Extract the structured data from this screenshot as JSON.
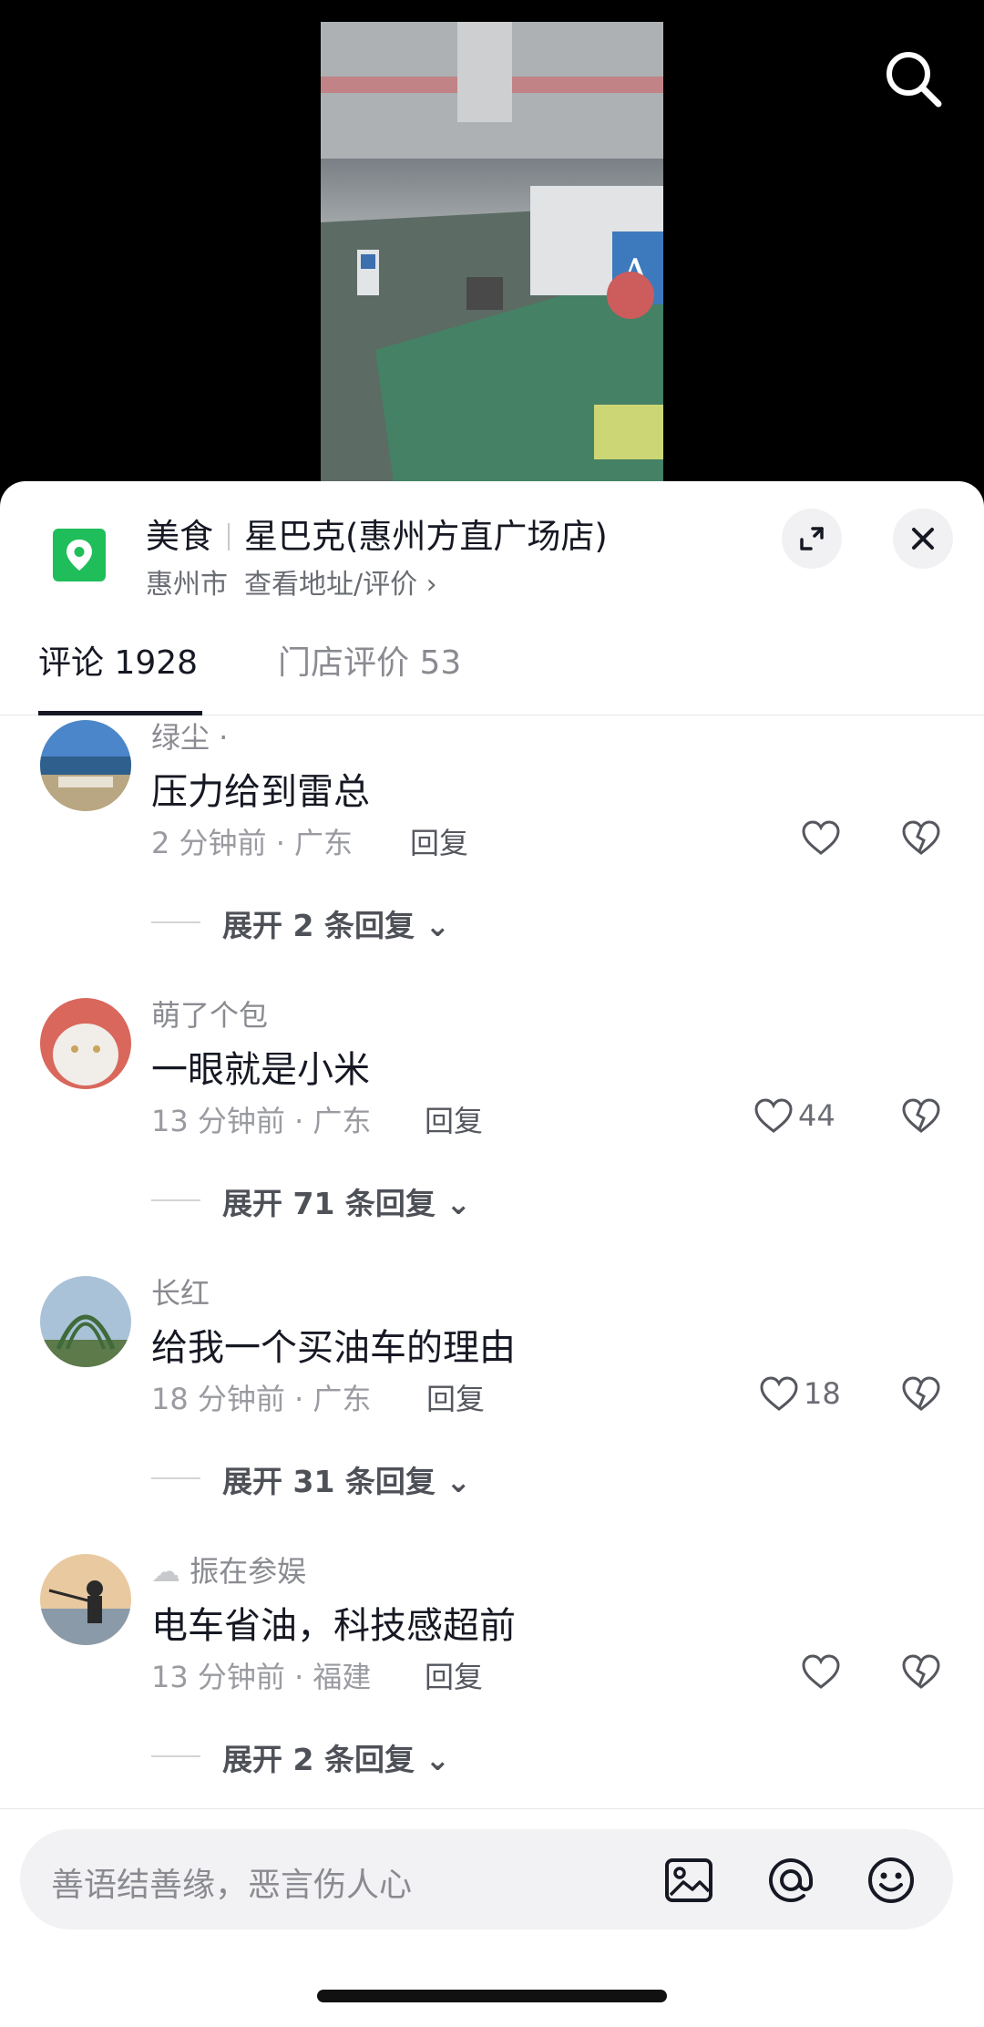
{
  "video": {
    "search_icon": "search-icon"
  },
  "poi": {
    "category": "美食",
    "store": "星巴克(惠州方直广场店)",
    "city": "惠州市",
    "address_link": "查看地址/评价 ›",
    "icon": "location-pin-icon",
    "accent": "#1fbe5a"
  },
  "tabs": [
    {
      "label": "评论 1928",
      "active": true
    },
    {
      "label": "门店评价 53",
      "active": false
    }
  ],
  "comments": [
    {
      "user": "绿尘 ·",
      "text": "压力给到雷总",
      "time": "2 分钟前 · 广东",
      "reply": "回复",
      "likes": "",
      "expand": "展开 2 条回复"
    },
    {
      "user": "萌了个包",
      "text": "一眼就是小米",
      "time": "13 分钟前 · 广东",
      "reply": "回复",
      "likes": "44",
      "expand": "展开 71 条回复"
    },
    {
      "user": "长红",
      "text": "给我一个买油车的理由",
      "time": "18 分钟前 · 广东",
      "reply": "回复",
      "likes": "18",
      "expand": "展开 31 条回复"
    },
    {
      "user": "振在参娱",
      "text": "电车省油，科技感超前",
      "time": "13 分钟前 · 福建",
      "reply": "回复",
      "likes": "",
      "expand": "展开 2 条回复"
    }
  ],
  "input": {
    "placeholder": "善语结善缘，恶言伤人心",
    "icons": [
      "image-icon",
      "at-icon",
      "emoji-icon"
    ]
  }
}
